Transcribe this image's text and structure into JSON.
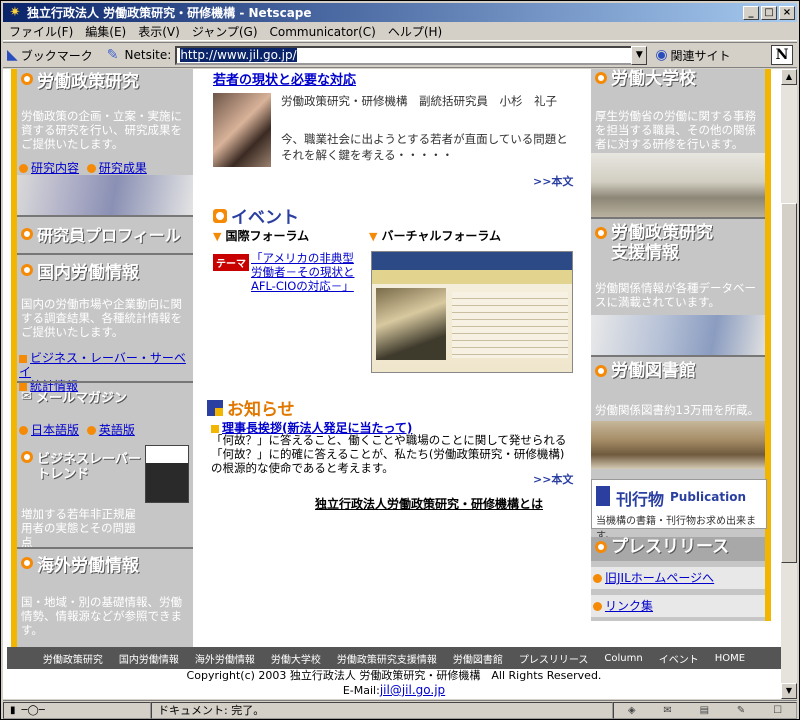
{
  "window": {
    "title": "独立行政法人 労働政策研究・研修機構 - Netscape",
    "controls": {
      "minimize": "_",
      "maximize": "□",
      "close": "×"
    }
  },
  "menu": [
    "ファイル(F)",
    "編集(E)",
    "表示(V)",
    "ジャンプ(G)",
    "Communicator(C)",
    "ヘルプ(H)"
  ],
  "toolbar": {
    "bookmark_label": "ブックマーク",
    "netsite_label": "Netsite:",
    "url": "http://www.jil.go.jp/",
    "related_label": "関連サイト",
    "logo": "N"
  },
  "left": {
    "policy_research": {
      "title": "労働政策研究",
      "desc": "労働政策の企画・立案・実施に資する研究を行い、研究成果をご提供いたします。",
      "links": [
        "研究内容",
        "研究成果"
      ]
    },
    "researcher_profile": {
      "title": "研究員プロフィール"
    },
    "domestic": {
      "title": "国内労働情報",
      "desc": "国内の労働市場や企業動向に関する調査結果、各種統計情報をご提供いたします。",
      "links": [
        "ビジネス・レーバー・サーベイ",
        "統計情報"
      ]
    },
    "mail": {
      "title": "メールマガジン",
      "links": [
        "日本語版",
        "英語版"
      ]
    },
    "trend": {
      "title_line1": "ビジネスレーバー",
      "title_line2": "トレンド",
      "desc": "増加する若年非正規雇用者の実態とその問題点"
    },
    "overseas": {
      "title": "海外労働情報",
      "desc": "国・地域・別の基礎情報、労働情勢、情報源などが参照できます。"
    }
  },
  "center": {
    "feature": {
      "headline": "若者の現状と必要な対応",
      "author": "労働政策研究・研修機構　副統括研究員　小杉　礼子",
      "summary": "今、職業社会に出ようとする若者が直面している問題とそれを解く鍵を考える・・・・・",
      "more": ">>本文"
    },
    "events": {
      "heading": "イベント",
      "intl_forum": "国際フォーラム",
      "virtual_forum": "バーチャルフォーラム",
      "theme_tag": "テーマ",
      "theme_link": "「アメリカの非典型労働者－その現状とAFL-CIOの対応－」"
    },
    "news": {
      "heading": "お知らせ",
      "item_title": "理事長挨拶(新法人発足に当たって)",
      "item_body": "「何故？」に答えること、働くことや職場のことに関して発せられる「何故？」に的確に答えることが、私たち(労働政策研究・研修機構)の根源的な使命であると考えます。",
      "more": ">>本文",
      "about": "独立行政法人労働政策研究・研修機構とは"
    }
  },
  "right": {
    "college": {
      "title": "労働大学校",
      "desc": "厚生労働省の労働に関する事務を担当する職員、その他の関係者に対する研修を行います。"
    },
    "support": {
      "title_line1": "労働政策研究",
      "title_line2": "支援情報",
      "desc": "労働関係情報が各種データベースに満載されています。"
    },
    "library": {
      "title": "労働図書館",
      "desc": "労働関係図書約13万冊を所蔵。"
    },
    "publication": {
      "title": "刊行物",
      "title_en": "Publication",
      "sub": "当機構の書籍・刊行物お求め出来ます。"
    },
    "press": {
      "title": "プレスリリース"
    },
    "old_home": "旧JILホームページへ",
    "links": "リンク集"
  },
  "footer": {
    "nav": [
      "労働政策研究",
      "国内労働情報",
      "海外労働情報",
      "労働大学校",
      "労働政策研究支援情報",
      "労働図書館",
      "プレスリリース",
      "Column",
      "イベント",
      "HOME"
    ],
    "copyright": "Copyright(c) 2003  独立行政法人 労働政策研究・研修機構　All Rights Reserved.",
    "email_label": "E-Mail:",
    "email": "jil@jil.go.jp"
  },
  "status": {
    "message": "ドキュメント: 完了。"
  }
}
